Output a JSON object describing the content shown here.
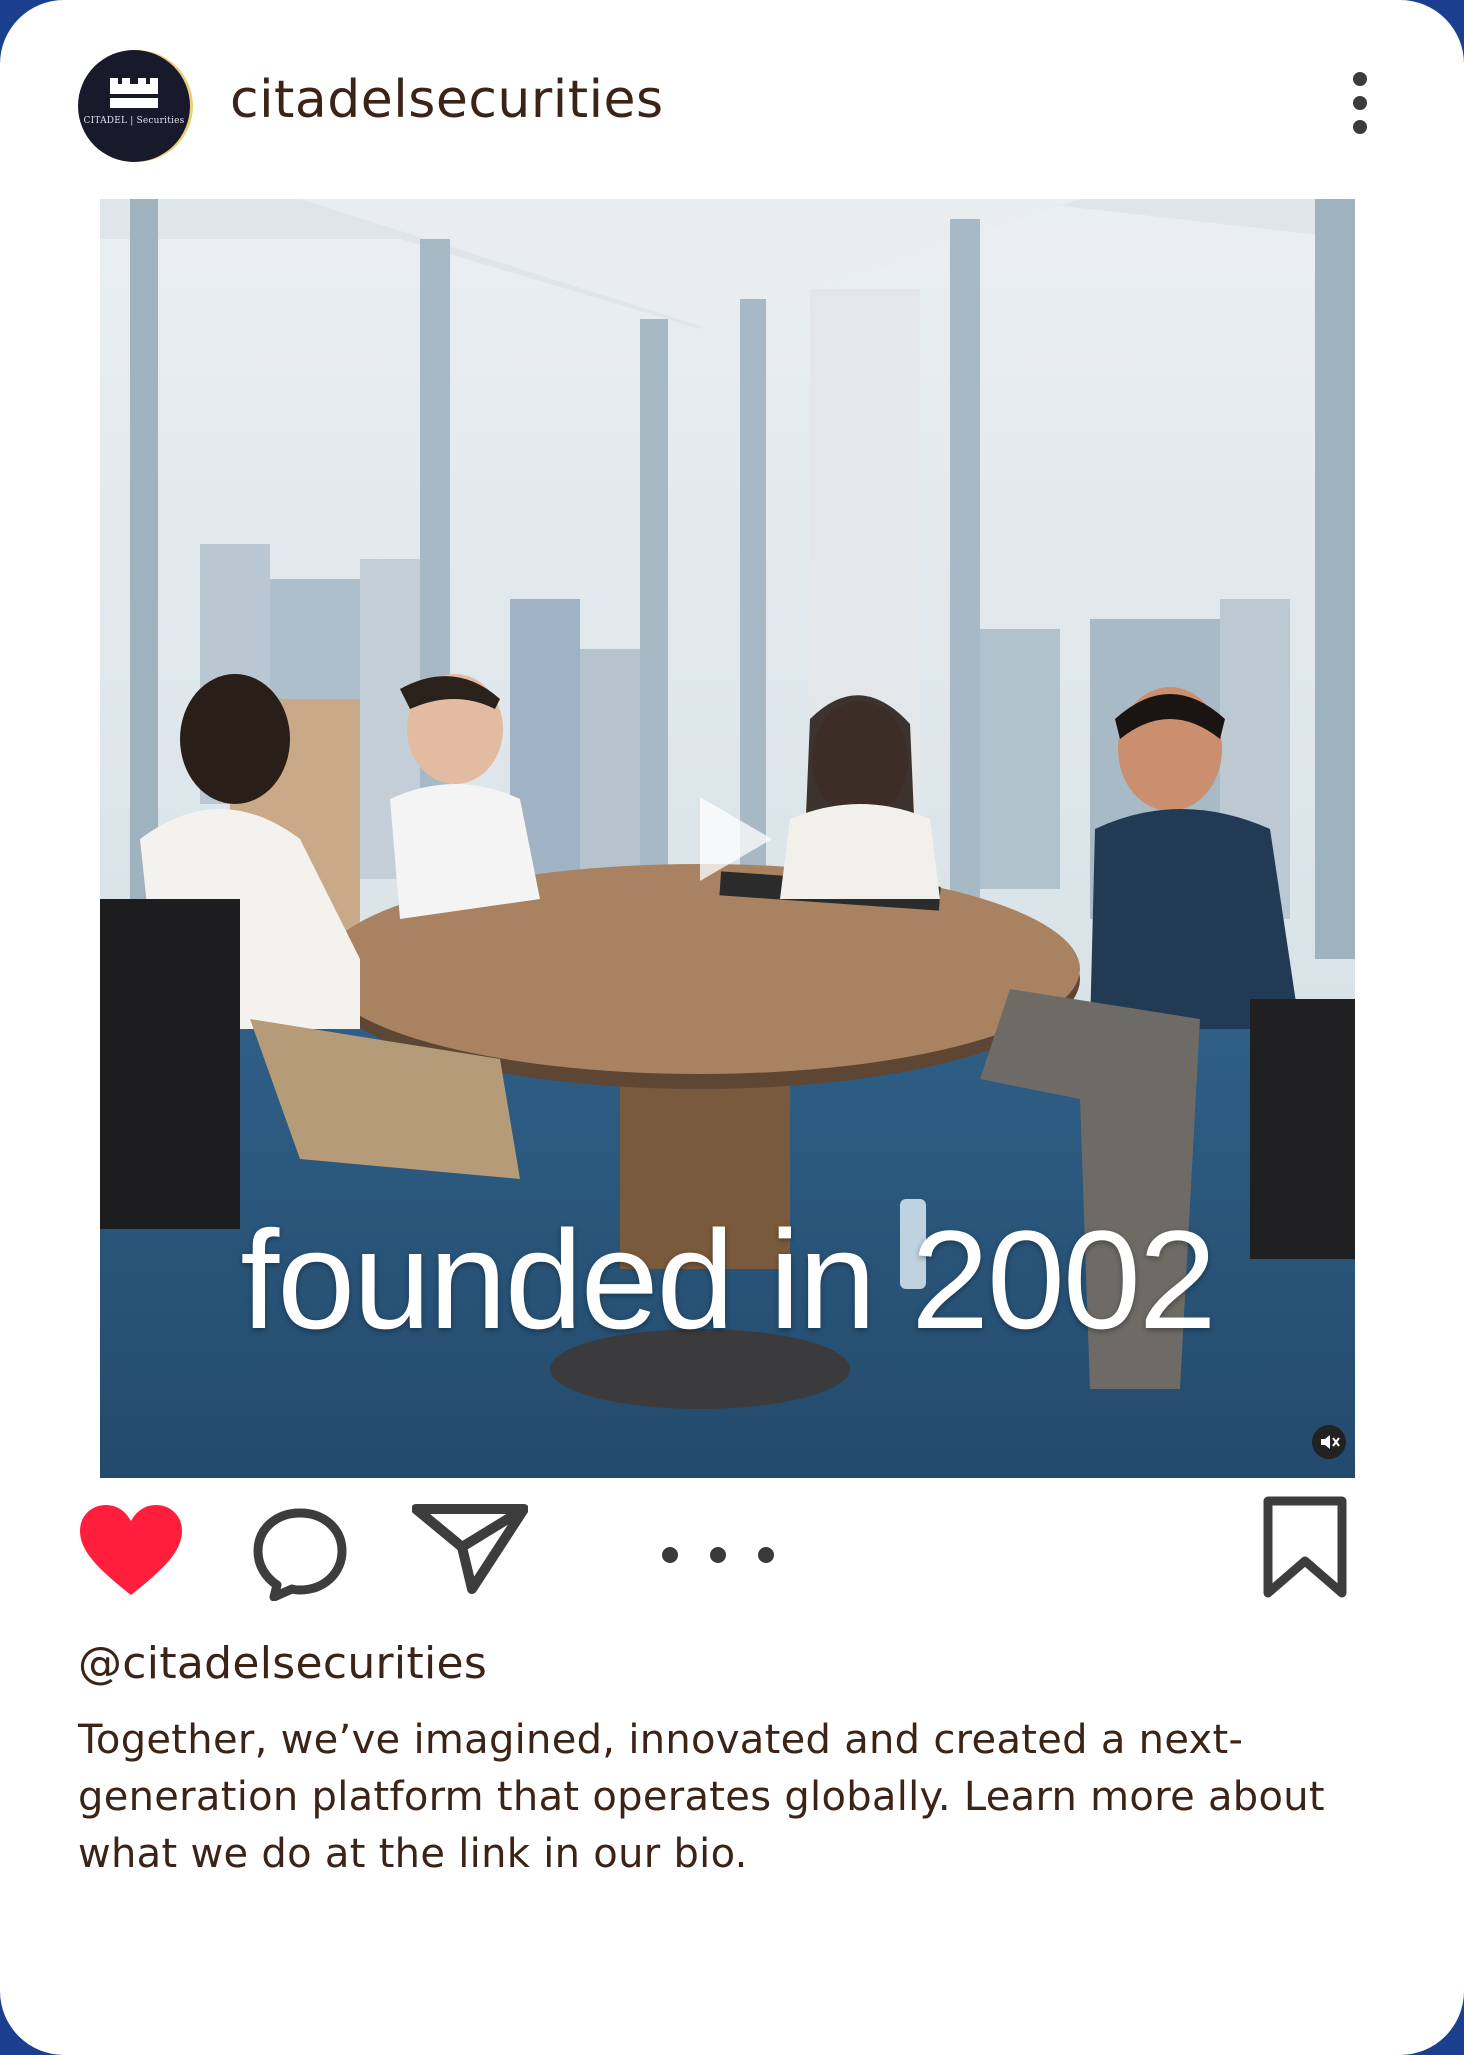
{
  "post": {
    "username": "citadelsecurities",
    "avatar_text": "CITADEL | Securities",
    "video_overlay_text": "founded in 2002",
    "handle": "@citadelsecurities",
    "caption": "Together, we’ve imagined, innovated and created a next-generation platform that operates globally. Learn more about what we do at the link in our bio.",
    "icons": [
      "more-options-icon",
      "play-icon",
      "mute-icon",
      "heart-icon",
      "comment-icon",
      "share-icon",
      "ellipsis-icon",
      "bookmark-icon"
    ],
    "colors": {
      "like_red": "#ff1f3d",
      "page_border_blue": "#1b3f8f",
      "text_brown": "#3b2417"
    }
  }
}
